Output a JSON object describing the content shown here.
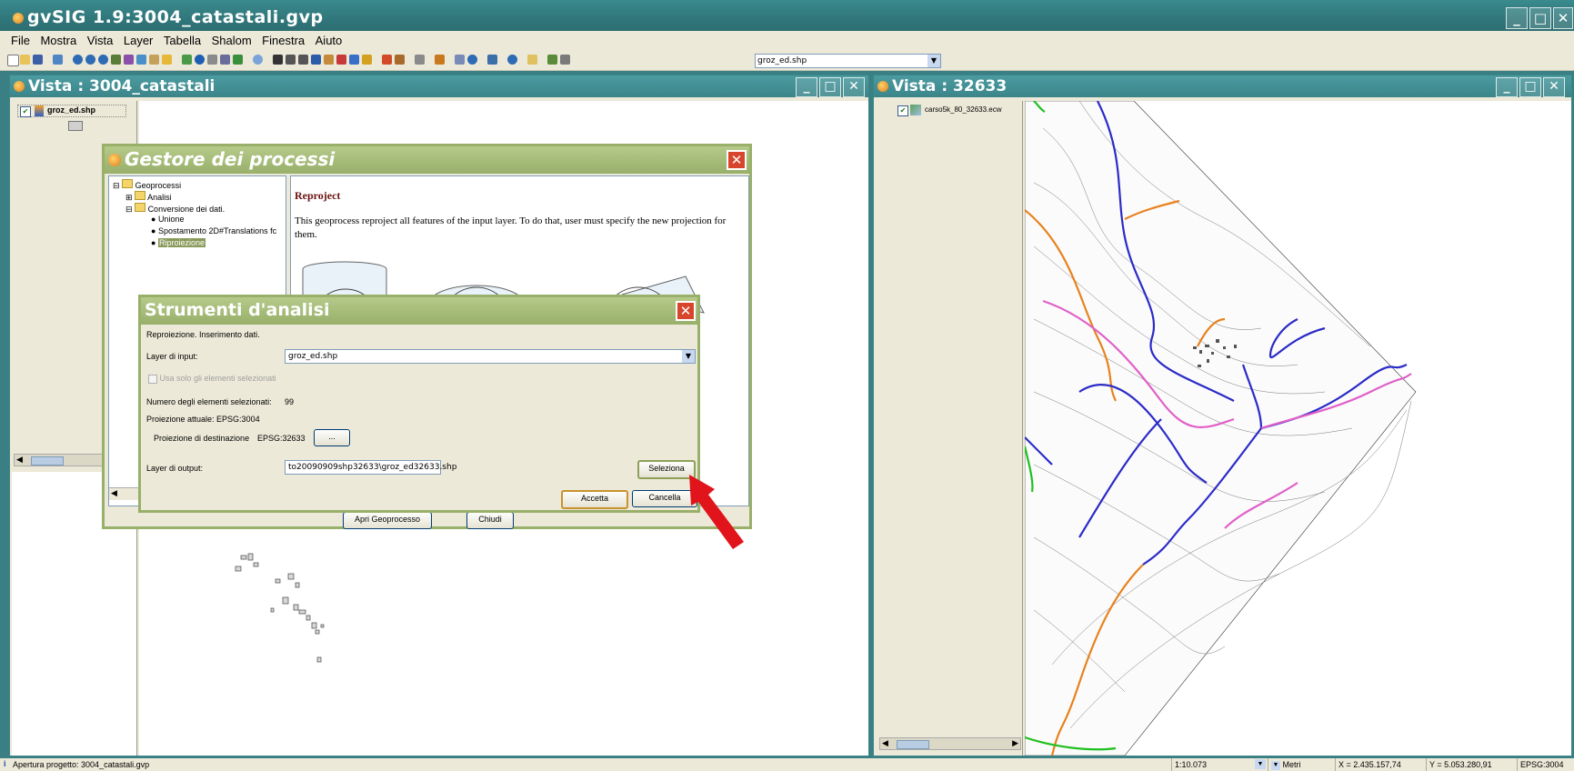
{
  "app": {
    "title": "gvSIG 1.9:3004_catastali.gvp",
    "menu": [
      "File",
      "Mostra",
      "Vista",
      "Layer",
      "Tabella",
      "Shalom",
      "Finestra",
      "Aiuto"
    ],
    "toolbar_layer_select": "groz_ed.shp"
  },
  "view_left": {
    "title": "Vista : 3004_catastali",
    "layers": [
      {
        "name": "groz_ed.shp",
        "checked": true
      }
    ]
  },
  "view_right": {
    "title": "Vista : 32633",
    "layers": [
      {
        "name": "carso5k_80_32633.ecw",
        "checked": true
      }
    ]
  },
  "process_manager": {
    "title": "Gestore dei processi",
    "tree": {
      "root": "Geoprocessi",
      "analisi": "Analisi",
      "conversione": "Conversione dei dati.",
      "items": [
        "Unione",
        "Spostamento 2D#Translations fc",
        "Riproiezione"
      ]
    },
    "desc_title": "Reproject",
    "desc_text": "This geoprocess reproject all features of the input layer. To do that, user must specify the new projection for them.",
    "btn_open": "Apri Geoprocesso",
    "btn_close": "Chiudi"
  },
  "analysis_tools": {
    "title": "Strumenti d'analisi",
    "subtitle": "Reproiezione. Inserimento dati.",
    "input_label": "Layer di input:",
    "input_value": "groz_ed.shp",
    "only_selected": "Usa solo gli elementi selezionati",
    "num_selected_label": "Numero degli elementi selezionati:",
    "num_selected_value": "99",
    "current_proj": "Proiezione attuale:  EPSG:3004",
    "dest_proj_label": "Proiezione di destinazione",
    "dest_proj_value": "EPSG:32633",
    "ellipsis": "...",
    "output_label": "Layer di output:",
    "output_value": "to20090909shp32633\\groz_ed32633.shp",
    "btn_select": "Seleziona",
    "btn_accept": "Accetta",
    "btn_cancel": "Cancella"
  },
  "status": {
    "message": "Apertura progetto: 3004_catastali.gvp",
    "scale": "1:10.073",
    "units": "Metri",
    "x": "X = 2.435.157,74",
    "y": "Y = 5.053.280,91",
    "epsg": "EPSG:3004"
  },
  "colors": {
    "titlebar": "#2f7478",
    "panel": "#ece9d8",
    "dialog_frame": "#8fa95f",
    "dialog_title": "#a7bc78",
    "arrow": "#e0141a"
  }
}
